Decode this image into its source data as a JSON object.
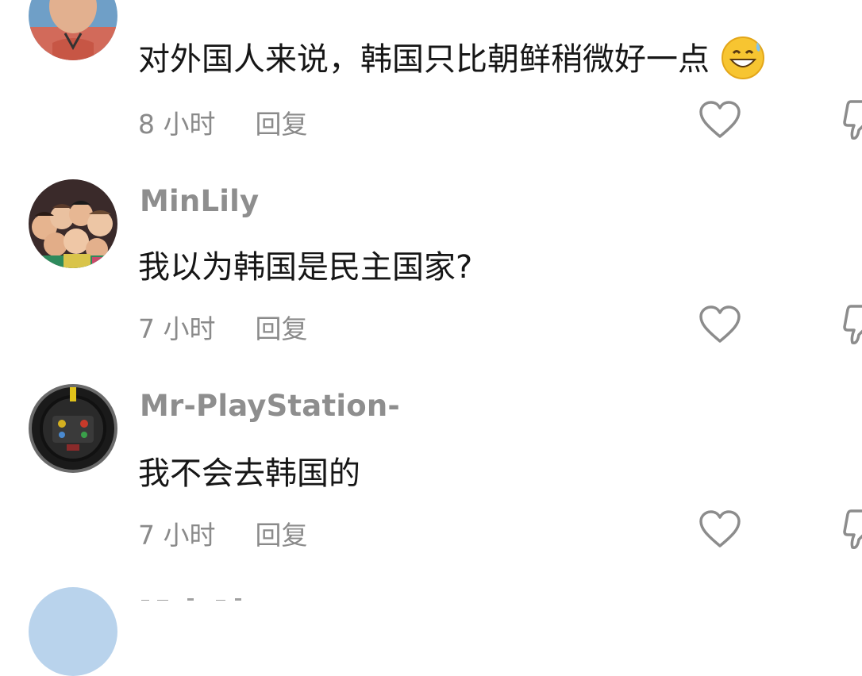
{
  "comments": [
    {
      "username": "",
      "text": "对外国人来说，韩国只比朝鲜稍微好一点",
      "emoji": "grinning-face-with-sweat-emoji",
      "time": "8 小时",
      "reply": "回复"
    },
    {
      "username": "MinLily",
      "text": "我以为韩国是民主国家?",
      "time": "7 小时",
      "reply": "回复"
    },
    {
      "username": "Mr-PlayStation-",
      "text": "我不会去韩国的",
      "time": "7 小时",
      "reply": "回复"
    }
  ],
  "colors": {
    "username": "#8e8e8e",
    "text": "#161616",
    "meta": "#8a8a8a",
    "icon": "#8c8c8c"
  }
}
